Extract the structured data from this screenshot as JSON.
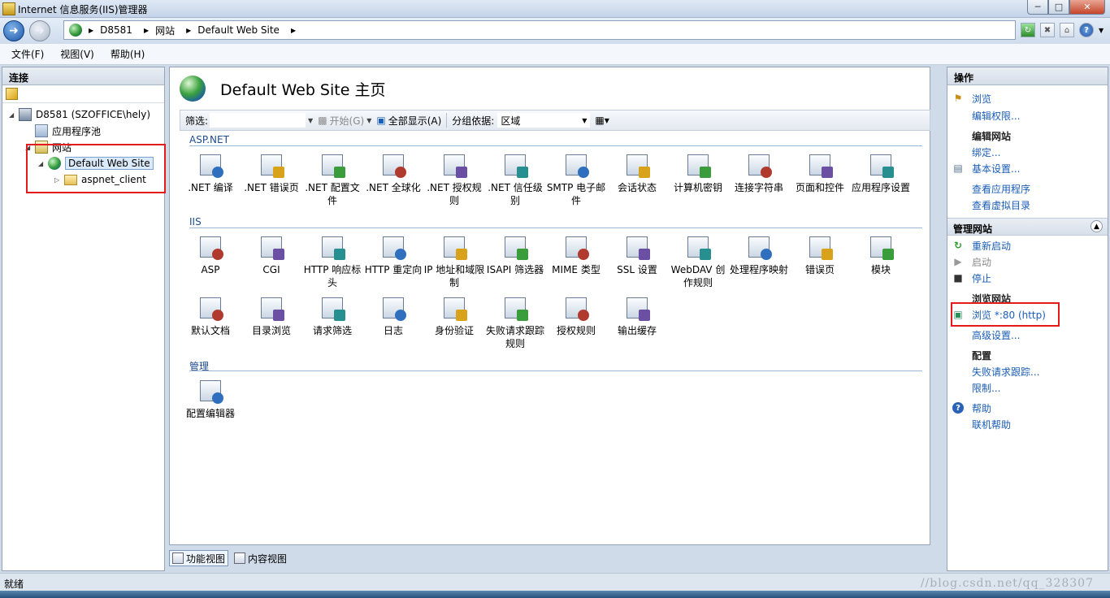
{
  "window": {
    "title": "Internet 信息服务(IIS)管理器"
  },
  "breadcrumb": {
    "items": [
      "D8581",
      "网站",
      "Default Web Site"
    ]
  },
  "menu": {
    "items": [
      "文件(F)",
      "视图(V)",
      "帮助(H)"
    ]
  },
  "connections": {
    "title": "连接",
    "tree": {
      "server": "D8581 (SZOFFICE\\hely)",
      "app_pools": "应用程序池",
      "sites": "网站",
      "site": "Default Web Site",
      "child": "aspnet_client"
    }
  },
  "main": {
    "title": "Default Web Site 主页",
    "filter_label": "筛选:",
    "start_label": "开始(G)",
    "show_all_label": "全部显示(A)",
    "group_by_label": "分组依据:",
    "group_by_value": "区域",
    "sections": {
      "aspnet": {
        "title": "ASP.NET",
        "items": [
          ".NET 编译",
          ".NET 错误页",
          ".NET 配置文件",
          ".NET 全球化",
          ".NET 授权规则",
          ".NET 信任级别",
          "SMTP 电子邮件",
          "会话状态",
          "计算机密钥",
          "连接字符串",
          "页面和控件",
          "应用程序设置"
        ]
      },
      "iis": {
        "title": "IIS",
        "items": [
          "ASP",
          "CGI",
          "HTTP 响应标头",
          "HTTP 重定向",
          "IP 地址和域限制",
          "ISAPI 筛选器",
          "MIME 类型",
          "SSL 设置",
          "WebDAV 创作规则",
          "处理程序映射",
          "错误页",
          "模块",
          "默认文档",
          "目录浏览",
          "请求筛选",
          "日志",
          "身份验证",
          "失败请求跟踪规则",
          "授权规则",
          "输出缓存"
        ]
      },
      "manage": {
        "title": "管理",
        "items": [
          "配置编辑器"
        ]
      }
    },
    "tabs": [
      "功能视图",
      "内容视图"
    ]
  },
  "actions": {
    "title": "操作",
    "browse": "浏览",
    "edit_permissions": "编辑权限...",
    "edit_site_header": "编辑网站",
    "bindings": "绑定...",
    "basic_settings": "基本设置...",
    "view_apps": "查看应用程序",
    "view_vdirs": "查看虚拟目录",
    "manage_site_header": "管理网站",
    "restart": "重新启动",
    "start": "启动",
    "stop": "停止",
    "browse_site_header": "浏览网站",
    "browse_http": "浏览 *:80 (http)",
    "advanced_settings": "高级设置...",
    "config_header": "配置",
    "failed_tracing": "失败请求跟踪...",
    "limits": "限制...",
    "help": "帮助",
    "online_help": "联机帮助"
  },
  "status": {
    "text": "就绪",
    "watermark": "//blog.csdn.net/qq_328307"
  }
}
